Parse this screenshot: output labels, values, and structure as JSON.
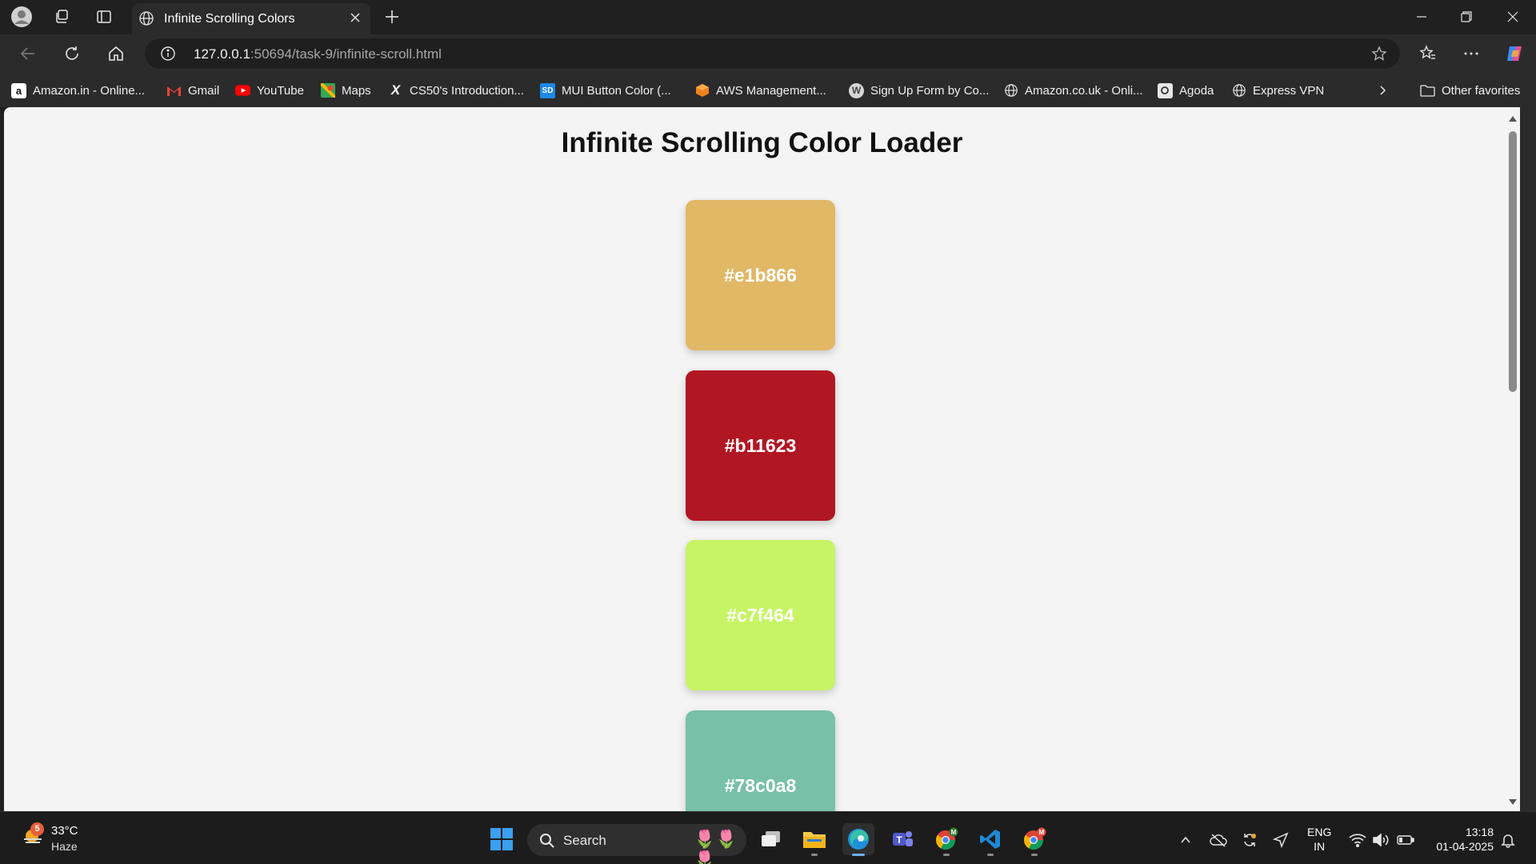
{
  "browser": {
    "tab_title": "Infinite Scrolling Colors",
    "url_host": "127.0.0.1",
    "url_path": ":50694/task-9/infinite-scroll.html"
  },
  "bookmarks": [
    {
      "label": "Amazon.in - Online...",
      "icon": "amazon-icon"
    },
    {
      "label": "Gmail",
      "icon": "gmail-icon"
    },
    {
      "label": "YouTube",
      "icon": "youtube-icon"
    },
    {
      "label": "Maps",
      "icon": "maps-icon"
    },
    {
      "label": "CS50's Introduction...",
      "icon": "x-icon"
    },
    {
      "label": "MUI Button Color (...",
      "icon": "sd-icon"
    },
    {
      "label": "AWS Management...",
      "icon": "aws-icon"
    },
    {
      "label": "Sign Up Form by Co...",
      "icon": "wordpress-icon"
    },
    {
      "label": "Amazon.co.uk - Onli...",
      "icon": "globe-icon"
    },
    {
      "label": "Agoda",
      "icon": "agoda-icon"
    },
    {
      "label": "Express VPN",
      "icon": "globe-icon"
    }
  ],
  "other_favorites": "Other favorites",
  "page": {
    "title": "Infinite Scrolling Color Loader",
    "swatches": [
      {
        "label": "#e1b866",
        "color": "#e1b866"
      },
      {
        "label": "#b11623",
        "color": "#b11623"
      },
      {
        "label": "#c7f464",
        "color": "#c7f464"
      },
      {
        "label": "#78c0a8",
        "color": "#78c0a8"
      }
    ]
  },
  "taskbar": {
    "weather_badge": "5",
    "temperature": "33°C",
    "condition": "Haze",
    "search_label": "Search",
    "language": "ENG",
    "region": "IN",
    "time": "13:18",
    "date": "01-04-2025"
  }
}
